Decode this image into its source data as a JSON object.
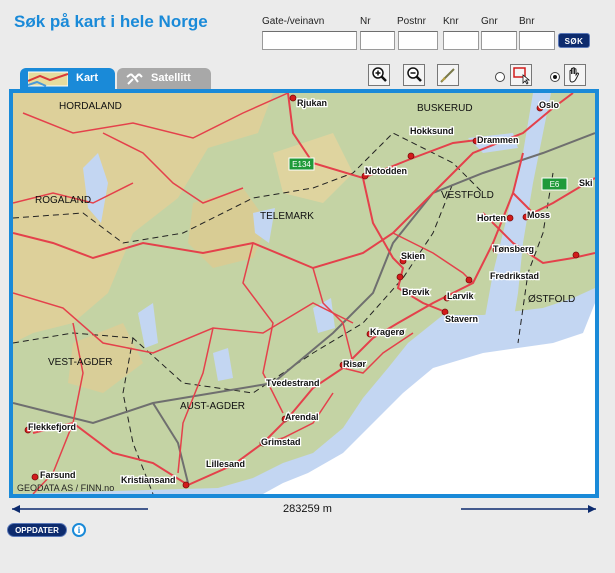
{
  "header": {
    "title": "Søk på kart i hele Norge"
  },
  "search": {
    "fields": [
      {
        "label": "Gate-/veinavn",
        "value": ""
      },
      {
        "label": "Nr",
        "value": ""
      },
      {
        "label": "Postnr",
        "value": ""
      },
      {
        "label": "Knr",
        "value": ""
      },
      {
        "label": "Gnr",
        "value": ""
      },
      {
        "label": "Bnr",
        "value": ""
      }
    ],
    "button_label": "SØK"
  },
  "tabs": [
    {
      "label": "Kart",
      "active": true
    },
    {
      "label": "Satellitt",
      "active": false
    }
  ],
  "toolbar": {
    "zoom_in": "zoom-in-icon",
    "zoom_out": "zoom-out-icon",
    "measure": "measure-icon",
    "select": "select-rectangle-icon",
    "pan": "pan-hand-icon",
    "mode_selected": "pan"
  },
  "map": {
    "region_labels": [
      "HORDALAND",
      "BUSKERUD",
      "ROGALAND",
      "TELEMARK",
      "VESTFOLD",
      "ØSTFOLD",
      "VEST-AGDER",
      "AUST-AGDER"
    ],
    "city_labels": [
      "Rjukan",
      "Oslo",
      "Hokksund",
      "Drammen",
      "Notodden",
      "Horten",
      "Moss",
      "Skien",
      "Tønsberg",
      "Brevik",
      "Larvik",
      "Fredrikstad",
      "Stavern",
      "Kragerø",
      "Risør",
      "Tvedestrand",
      "Arendal",
      "Grimstad",
      "Flekkefjord",
      "Lillesand",
      "Farsund",
      "Kristiansand",
      "Ski"
    ],
    "road_signs": [
      "E134",
      "E6"
    ],
    "attribution": "GEODATA AS / FINN.no"
  },
  "scale": {
    "text": "283259 m"
  },
  "footer": {
    "update_label": "OPPDATER",
    "info_icon": "info-icon"
  },
  "colors": {
    "accent": "#1a8ad8",
    "button": "#0d2b6e",
    "land": "#c4d3a4",
    "sea": "#c3d6f2",
    "road": "#e4414b"
  }
}
